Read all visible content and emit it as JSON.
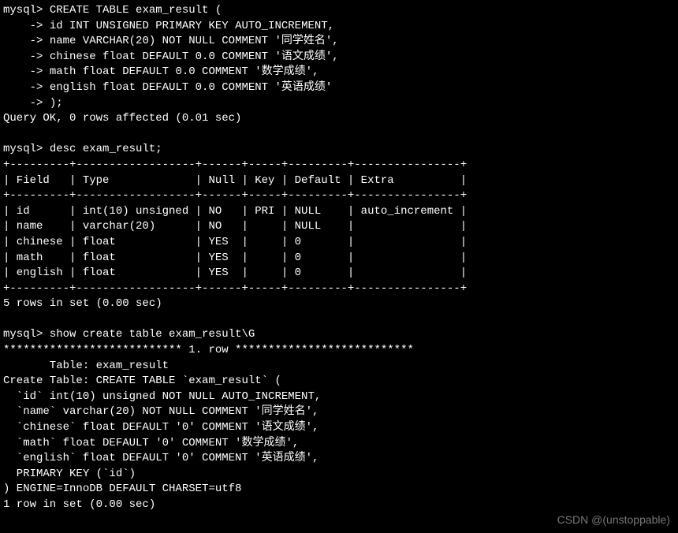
{
  "terminal": {
    "prompt": "mysql>",
    "cont_prompt": "    ->",
    "create_table_cmd": "CREATE TABLE exam_result (",
    "create_col_id": "id INT UNSIGNED PRIMARY KEY AUTO_INCREMENT,",
    "create_col_name": "name VARCHAR(20) NOT NULL COMMENT '同学姓名',",
    "create_col_chinese": "chinese float DEFAULT 0.0 COMMENT '语文成绩',",
    "create_col_math": "math float DEFAULT 0.0 COMMENT '数学成绩',",
    "create_col_english": "english float DEFAULT 0.0 COMMENT '英语成绩'",
    "create_close": ");",
    "create_result": "Query OK, 0 rows affected (0.01 sec)",
    "desc_cmd": "desc exam_result;",
    "desc_border": "+---------+------------------+------+-----+---------+----------------+",
    "desc_header": "| Field   | Type             | Null | Key | Default | Extra          |",
    "desc_rows": [
      "| id      | int(10) unsigned | NO   | PRI | NULL    | auto_increment |",
      "| name    | varchar(20)      | NO   |     | NULL    |                |",
      "| chinese | float            | YES  |     | 0       |                |",
      "| math    | float            | YES  |     | 0       |                |",
      "| english | float            | YES  |     | 0       |                |"
    ],
    "desc_footer": "5 rows in set (0.00 sec)",
    "show_cmd": "show create table exam_result\\G",
    "show_rowsep": "*************************** 1. row ***************************",
    "show_table_line": "       Table: exam_result",
    "show_create_lines": [
      "Create Table: CREATE TABLE `exam_result` (",
      "  `id` int(10) unsigned NOT NULL AUTO_INCREMENT,",
      "  `name` varchar(20) NOT NULL COMMENT '同学姓名',",
      "  `chinese` float DEFAULT '0' COMMENT '语文成绩',",
      "  `math` float DEFAULT '0' COMMENT '数学成绩',",
      "  `english` float DEFAULT '0' COMMENT '英语成绩',",
      "  PRIMARY KEY (`id`)",
      ") ENGINE=InnoDB DEFAULT CHARSET=utf8"
    ],
    "show_footer": "1 row in set (0.00 sec)"
  },
  "watermark": "CSDN @(unstoppable)"
}
